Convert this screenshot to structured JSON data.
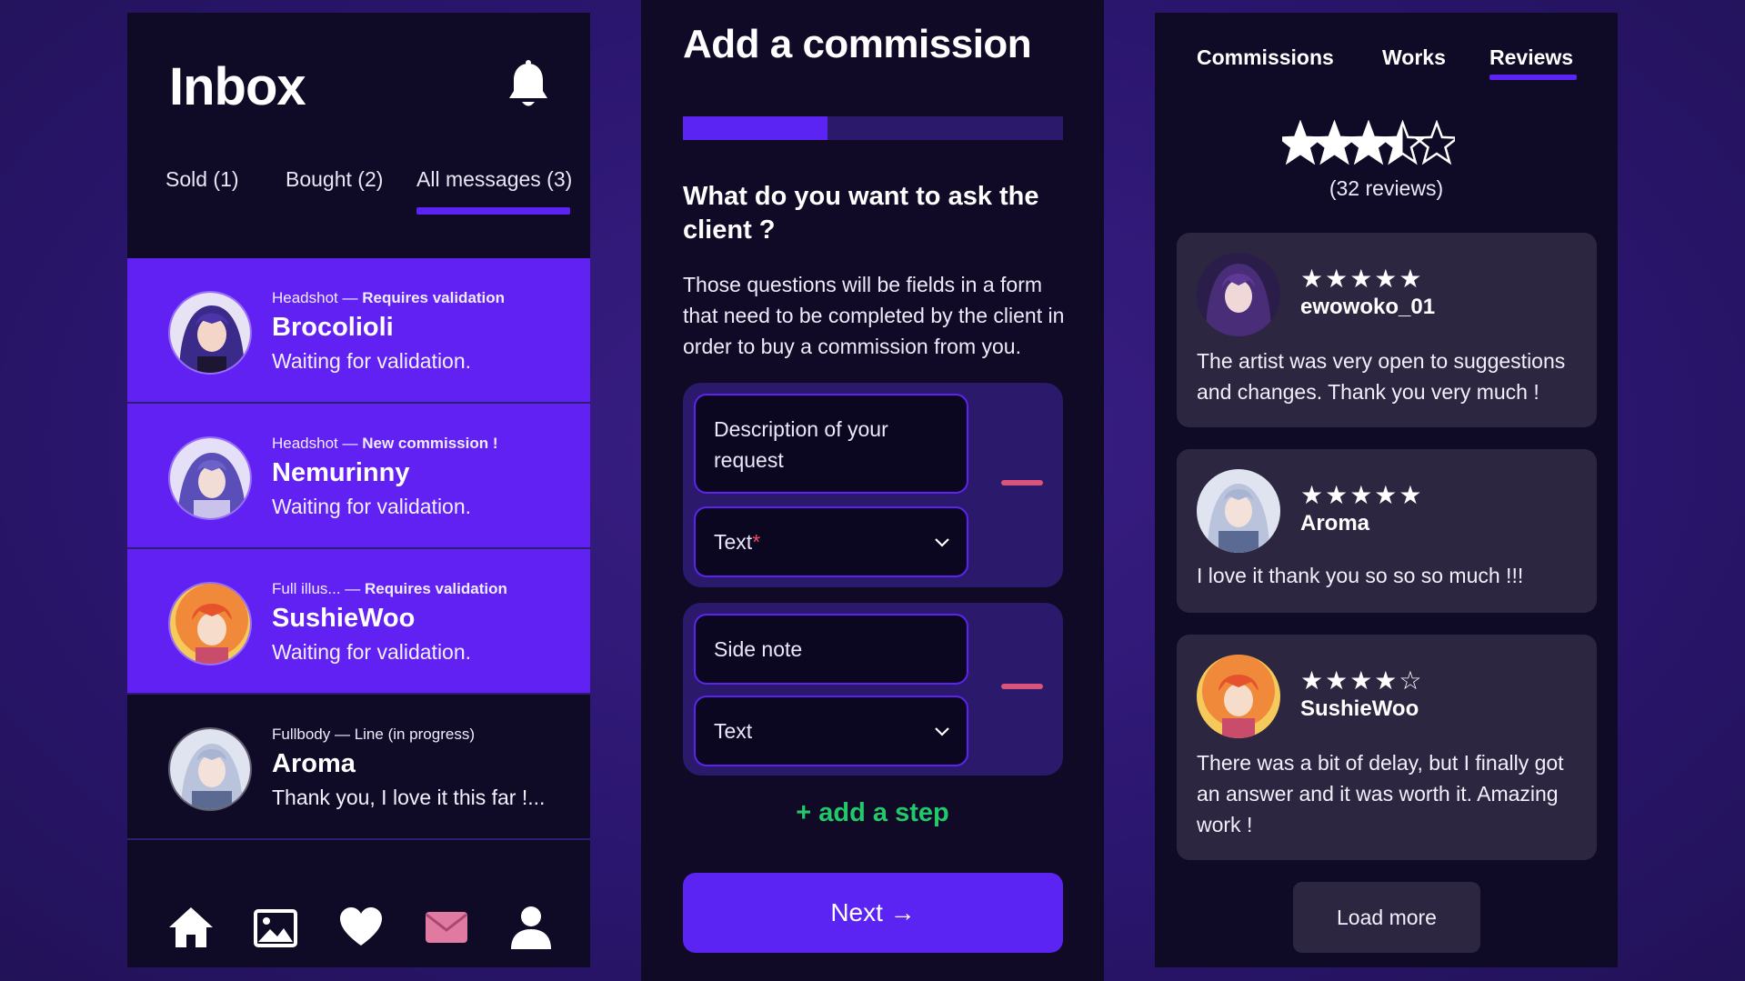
{
  "inbox": {
    "title": "Inbox",
    "tabs": [
      {
        "label": "Sold (1)"
      },
      {
        "label": "Bought (2)"
      },
      {
        "label": "All messages (3)",
        "active": true
      }
    ],
    "messages": [
      {
        "category": "Headshot — ",
        "status": "Requires validation",
        "name": "Brocolioli",
        "preview": "Waiting for validation.",
        "highlighted": true
      },
      {
        "category": "Headshot — ",
        "status": "New commission !",
        "name": "Nemurinny",
        "preview": "Waiting for validation.",
        "highlighted": true
      },
      {
        "category": "Full illus... — ",
        "status": "Requires validation",
        "name": "SushieWoo",
        "preview": "Waiting for validation.",
        "highlighted": true
      },
      {
        "category": "Fullbody — Line (in progress)",
        "status": "",
        "name": "Aroma",
        "preview": "Thank you, I love it this far !...",
        "highlighted": false
      }
    ],
    "nav": [
      "home-icon",
      "gallery-icon",
      "heart-icon",
      "mail-icon",
      "profile-icon"
    ]
  },
  "commission": {
    "title": "Add a commission",
    "progress": 0.38,
    "question": "What do you want to ask the client ?",
    "description": "Those questions will be fields in a form that need to be completed by the client in order to buy a commission from you.",
    "steps": [
      {
        "field": "Description of your request",
        "type": "Text",
        "required": "*"
      },
      {
        "field": "Side note",
        "type": "Text",
        "required": ""
      }
    ],
    "add_step": "+ add a step",
    "next": "Next →"
  },
  "reviews": {
    "tabs": [
      {
        "label": "Commissions"
      },
      {
        "label": "Works"
      },
      {
        "label": "Reviews",
        "active": true
      }
    ],
    "rating": 3.5,
    "count_label": "(32 reviews)",
    "items": [
      {
        "stars": "★★★★★",
        "user": "ewowoko_01",
        "text": "The artist was very open to suggestions and changes. Thank you very much !"
      },
      {
        "stars": "★★★★★",
        "user": "Aroma",
        "text": "I love it thank you so so so much !!!"
      },
      {
        "stars": "★★★★☆",
        "user": "SushieWoo",
        "text": "There was a bit of delay, but I finally got an answer and it was worth it. Amazing work !"
      }
    ],
    "load_more": "Load more"
  },
  "colors": {
    "accent": "#5b24f2",
    "highlight_row": "#6121f2",
    "panel_bg": "#0f0a25",
    "card_bg": "#2c2640",
    "add_step_green": "#22c86a",
    "remove_pink": "#d9537c",
    "mail_pink": "#e07aa0"
  }
}
